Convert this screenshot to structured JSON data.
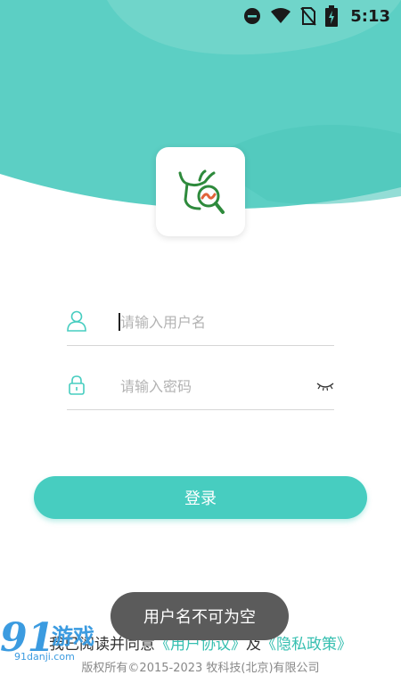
{
  "status_bar": {
    "time": "5:13",
    "icons": [
      "do-not-disturb-icon",
      "wifi-icon",
      "no-sim-icon",
      "battery-charging-icon"
    ]
  },
  "colors": {
    "accent": "#47cdc0",
    "header_bg": "#5ccfc4",
    "link": "#36bfb0",
    "toast_bg": "#5b5b5b"
  },
  "login": {
    "username_placeholder": "请输入用户名",
    "password_placeholder": "请输入密码",
    "submit_label": "登录"
  },
  "agreement": {
    "prefix": "我已阅读并同意",
    "user_agreement": "《用户协议》",
    "joiner": "及",
    "privacy_policy": "《隐私政策》"
  },
  "copyright": "版权所有©2015-2023 牧科技(北京)有限公司",
  "toast": "用户名不可为空",
  "watermark": {
    "mark": "91",
    "name": "游戏",
    "url": "91danji.com"
  }
}
